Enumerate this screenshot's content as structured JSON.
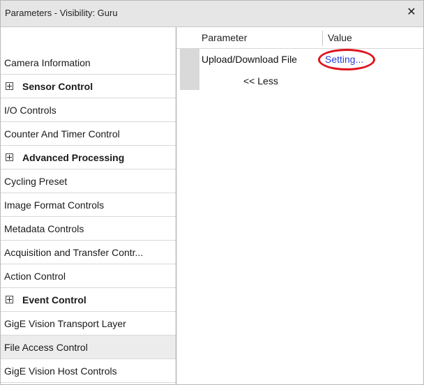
{
  "window": {
    "title": "Parameters - Visibility: Guru",
    "close_label": "✕"
  },
  "sidebar": {
    "items": [
      {
        "label": "Camera Information",
        "expandable": false,
        "selected": false
      },
      {
        "label": "Sensor Control",
        "expandable": true,
        "selected": false
      },
      {
        "label": "I/O Controls",
        "expandable": false,
        "selected": false
      },
      {
        "label": "Counter And Timer Control",
        "expandable": false,
        "selected": false
      },
      {
        "label": "Advanced Processing",
        "expandable": true,
        "selected": false
      },
      {
        "label": "Cycling Preset",
        "expandable": false,
        "selected": false
      },
      {
        "label": "Image Format Controls",
        "expandable": false,
        "selected": false
      },
      {
        "label": "Metadata Controls",
        "expandable": false,
        "selected": false
      },
      {
        "label": "Acquisition and Transfer Contr...",
        "expandable": false,
        "selected": false
      },
      {
        "label": "Action Control",
        "expandable": false,
        "selected": false
      },
      {
        "label": "Event Control",
        "expandable": true,
        "selected": false
      },
      {
        "label": "GigE Vision Transport Layer",
        "expandable": false,
        "selected": false
      },
      {
        "label": "File Access Control",
        "expandable": false,
        "selected": true
      },
      {
        "label": "GigE Vision Host Controls",
        "expandable": false,
        "selected": false
      }
    ]
  },
  "grid": {
    "columns": {
      "parameter": "Parameter",
      "value": "Value"
    },
    "rows": [
      {
        "parameter": "Upload/Download File",
        "value": "Setting..."
      }
    ],
    "less_label": "<< Less"
  },
  "colors": {
    "link": "#2a3fd6",
    "highlight": "#e0121b",
    "selected_bg": "#ececec"
  }
}
